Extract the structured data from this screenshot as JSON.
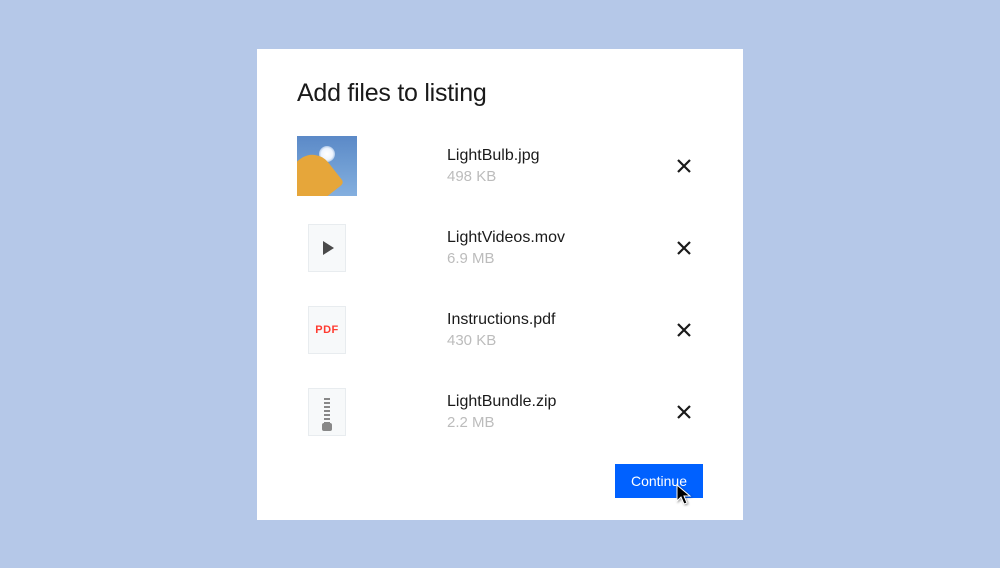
{
  "modal": {
    "title": "Add files to listing",
    "continue_label": "Continue"
  },
  "files": [
    {
      "name": "LightBulb.jpg",
      "size": "498 KB",
      "icon": "image"
    },
    {
      "name": "LightVideos.mov",
      "size": "6.9 MB",
      "icon": "video"
    },
    {
      "name": "Instructions.pdf",
      "size": "430 KB",
      "icon": "pdf",
      "pdf_label": "PDF"
    },
    {
      "name": "LightBundle.zip",
      "size": "2.2 MB",
      "icon": "zip"
    }
  ]
}
